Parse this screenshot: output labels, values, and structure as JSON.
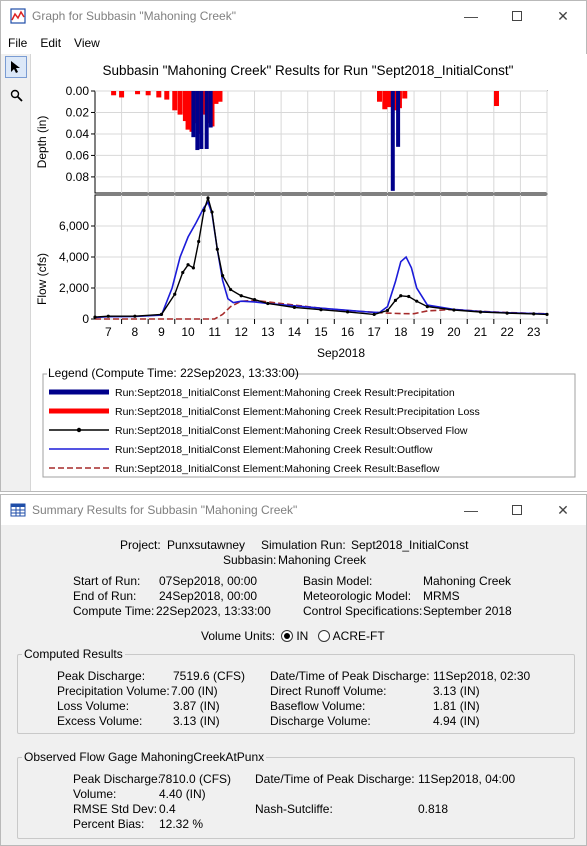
{
  "graph_window": {
    "title": "Graph for Subbasin \"Mahoning Creek\"",
    "menu": [
      "File",
      "Edit",
      "View"
    ],
    "tools": [
      "pointer-icon",
      "zoom-icon"
    ],
    "controls": [
      "minimize",
      "maximize",
      "close"
    ]
  },
  "chart_data": [
    {
      "type": "bar",
      "title": "Subbasin \"Mahoning Creek\" Results for Run \"Sept2018_InitialConst\"",
      "ylabel": "Depth (in)",
      "ylim": [
        0.095,
        0.0
      ],
      "yticks": [
        "0.00",
        "0.02",
        "0.04",
        "0.06",
        "0.08"
      ],
      "series": [
        {
          "name": "Run:Sept2018_InitialConst Element:Mahoning Creek Result:Precipitation",
          "color": "#00008b",
          "x": [
            10.2,
            10.35,
            10.5,
            10.7,
            10.85,
            17.7,
            17.9
          ],
          "values": [
            0.043,
            0.055,
            0.054,
            0.054,
            0.034,
            0.093,
            0.052
          ]
        },
        {
          "name": "Run:Sept2018_InitialConst Element:Mahoning Creek Result:Precipitation Loss",
          "color": "#ff0000",
          "x": [
            7.2,
            7.5,
            8.1,
            8.5,
            8.9,
            9.2,
            9.5,
            9.7,
            9.9,
            10.0,
            10.15,
            10.3,
            10.45,
            10.6,
            10.75,
            10.9,
            11.05,
            11.2,
            17.2,
            17.4,
            17.55,
            17.75,
            17.95,
            18.15,
            21.6
          ],
          "values": [
            0.004,
            0.006,
            0.003,
            0.004,
            0.006,
            0.008,
            0.018,
            0.022,
            0.028,
            0.036,
            0.038,
            0.03,
            0.04,
            0.022,
            0.03,
            0.033,
            0.012,
            0.01,
            0.01,
            0.017,
            0.015,
            0.018,
            0.016,
            0.007,
            0.014
          ]
        }
      ]
    },
    {
      "type": "line",
      "xlabel": "Sep2018",
      "ylabel": "Flow (cfs)",
      "ylim": [
        0,
        8000
      ],
      "yticks": [
        "0",
        "2,000",
        "4,000",
        "6,000"
      ],
      "xlim": [
        6.5,
        23.5
      ],
      "xticks": [
        "7",
        "8",
        "9",
        "10",
        "11",
        "12",
        "13",
        "14",
        "15",
        "16",
        "17",
        "18",
        "19",
        "20",
        "21",
        "22",
        "23"
      ],
      "series": [
        {
          "name": "Run:Sept2018_InitialConst Element:Mahoning Creek Result:Observed Flow",
          "color": "#000000",
          "x": [
            6.5,
            7,
            8,
            9,
            9.5,
            9.8,
            10,
            10.2,
            10.4,
            10.6,
            10.75,
            10.9,
            11.1,
            11.3,
            11.6,
            12,
            12.5,
            13,
            14,
            15,
            16,
            17,
            17.5,
            17.8,
            18,
            18.3,
            18.6,
            19,
            20,
            21,
            22,
            23,
            23.5
          ],
          "values": [
            120,
            180,
            180,
            300,
            1600,
            3000,
            3500,
            3300,
            5000,
            7000,
            7810,
            6900,
            4500,
            2800,
            1900,
            1500,
            1250,
            1000,
            750,
            600,
            460,
            300,
            550,
            1200,
            1500,
            1450,
            1150,
            800,
            580,
            450,
            380,
            330,
            300
          ]
        },
        {
          "name": "Run:Sept2018_InitialConst Element:Mahoning Creek Result:Outflow",
          "color": "#1c1cd9",
          "x": [
            6.5,
            7,
            8,
            9,
            9.4,
            9.7,
            10,
            10.3,
            10.6,
            10.75,
            10.9,
            11.1,
            11.3,
            11.5,
            11.7,
            12,
            12.5,
            13,
            14,
            15,
            16,
            16.8,
            17.2,
            17.5,
            17.8,
            18.0,
            18.2,
            18.4,
            18.6,
            19,
            20,
            21,
            22,
            23,
            23.5
          ],
          "values": [
            100,
            150,
            160,
            250,
            2000,
            4000,
            5300,
            6200,
            7200,
            7520,
            6800,
            4500,
            2500,
            1300,
            1050,
            1150,
            1100,
            1000,
            850,
            700,
            560,
            450,
            420,
            800,
            2400,
            3700,
            4000,
            3300,
            2000,
            900,
            620,
            480,
            400,
            350,
            330
          ]
        },
        {
          "name": "Run:Sept2018_InitialConst Element:Mahoning Creek Result:Baseflow",
          "color": "#a52a2a",
          "dashed": true,
          "x": [
            6.5,
            11,
            11.3,
            11.6,
            12,
            12.5,
            13,
            14,
            15,
            16,
            17,
            17.5,
            18,
            18.5,
            19,
            20,
            21,
            22,
            23,
            23.5
          ],
          "values": [
            0,
            0,
            300,
            800,
            1150,
            1200,
            1100,
            900,
            700,
            550,
            430,
            380,
            350,
            340,
            520,
            620,
            500,
            420,
            360,
            340
          ]
        }
      ]
    }
  ],
  "legend": {
    "title": "Legend (Compute Time: 22Sep2023, 13:33:00)",
    "entries": [
      {
        "label": "Run:Sept2018_InitialConst Element:Mahoning Creek Result:Precipitation",
        "color": "#00008b",
        "style": "thick"
      },
      {
        "label": "Run:Sept2018_InitialConst Element:Mahoning Creek Result:Precipitation Loss",
        "color": "#ff0000",
        "style": "thick"
      },
      {
        "label": "Run:Sept2018_InitialConst Element:Mahoning Creek Result:Observed Flow",
        "color": "#000000",
        "style": "marker"
      },
      {
        "label": "Run:Sept2018_InitialConst Element:Mahoning Creek Result:Outflow",
        "color": "#1c1cd9",
        "style": "line"
      },
      {
        "label": "Run:Sept2018_InitialConst Element:Mahoning Creek Result:Baseflow",
        "color": "#a52a2a",
        "style": "dashed"
      }
    ]
  },
  "summary_window": {
    "title": "Summary Results for Subbasin \"Mahoning Creek\"",
    "project_label": "Project:",
    "project": "Punxsutawney",
    "sim_run_label": "Simulation Run:",
    "sim_run": "Sept2018_InitialConst",
    "subbasin_label": "Subbasin:",
    "subbasin": "Mahoning Creek",
    "start_label": "Start of Run:",
    "start": "07Sep2018, 00:00",
    "end_label": "End of Run:",
    "end": "24Sep2018, 00:00",
    "compute_label": "Compute Time:",
    "compute": "22Sep2023, 13:33:00",
    "basin_label": "Basin Model:",
    "basin": "Mahoning Creek",
    "met_label": "Meteorologic Model:",
    "met": "MRMS",
    "control_label": "Control Specifications:",
    "control": "September 2018",
    "volume_units_label": "Volume Units:",
    "unit_in": "IN",
    "unit_acreft": "ACRE-FT",
    "selected_unit": "IN",
    "computed": {
      "title": "Computed Results",
      "peak_discharge_label": "Peak Discharge:",
      "peak_discharge": "7519.6 (CFS)",
      "peak_time_label": "Date/Time of Peak Discharge:",
      "peak_time": "11Sep2018, 02:30",
      "precip_label": "Precipitation Volume:",
      "precip": "7.00 (IN)",
      "direct_label": "Direct Runoff Volume:",
      "direct": "3.13 (IN)",
      "loss_label": "Loss Volume:",
      "loss": "3.87 (IN)",
      "baseflow_label": "Baseflow Volume:",
      "baseflow": "1.81 (IN)",
      "excess_label": "Excess Volume:",
      "excess": "3.13 (IN)",
      "discharge_label": "Discharge Volume:",
      "discharge": "4.94 (IN)"
    },
    "observed": {
      "title": "Observed Flow Gage MahoningCreekAtPunx",
      "peak_discharge_label": "Peak Discharge:",
      "peak_discharge": "7810.0 (CFS)",
      "peak_time_label": "Date/Time of Peak Discharge:",
      "peak_time": "11Sep2018, 04:00",
      "volume_label": "Volume:",
      "volume": "4.40 (IN)",
      "rmse_label": "RMSE Std Dev:",
      "rmse": "0.4",
      "nash_label": "Nash-Sutcliffe:",
      "nash": "0.818",
      "bias_label": "Percent Bias:",
      "bias": "12.32 %"
    }
  }
}
